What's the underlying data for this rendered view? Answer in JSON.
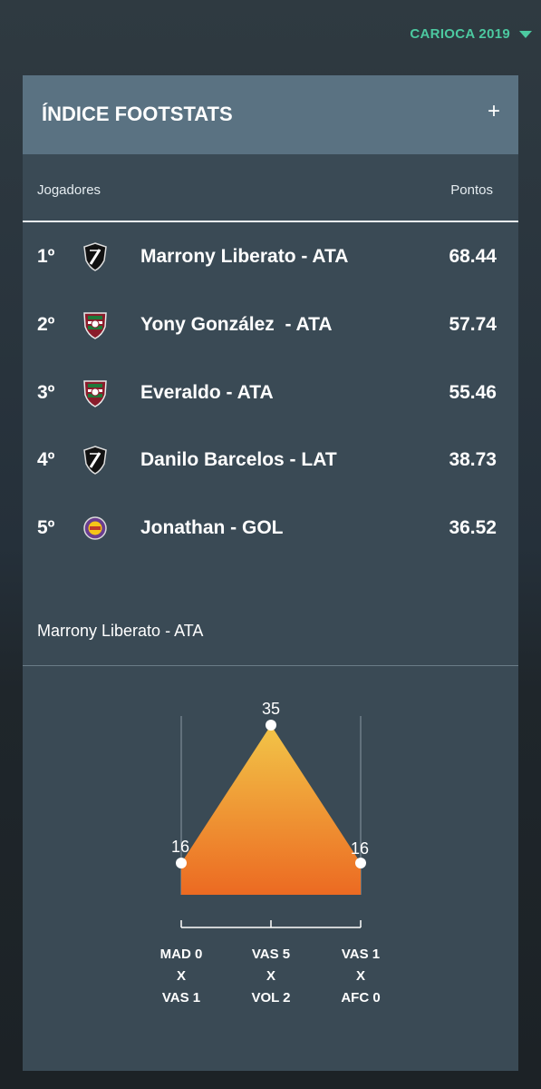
{
  "season_selector": {
    "label": "CARIOCA 2019"
  },
  "card": {
    "title": "ÍNDICE FOOTSTATS",
    "expand_label": "+",
    "columns": {
      "players": "Jogadores",
      "points": "Pontos"
    }
  },
  "rankings": [
    {
      "rank": "1º",
      "player": "Marrony Liberato - ATA",
      "points": "68.44",
      "crest": "vasco-crest-icon"
    },
    {
      "rank": "2º",
      "player": "Yony González  - ATA",
      "points": "57.74",
      "crest": "fluminense-crest-icon"
    },
    {
      "rank": "3º",
      "player": "Everaldo - ATA",
      "points": "55.46",
      "crest": "fluminense-crest-icon"
    },
    {
      "rank": "4º",
      "player": "Danilo Barcelos - LAT",
      "points": "38.73",
      "crest": "vasco-crest-icon"
    },
    {
      "rank": "5º",
      "player": "Jonathan - GOL",
      "points": "36.52",
      "crest": "madureira-crest-icon"
    }
  ],
  "detail": {
    "title": "Marrony Liberato - ATA"
  },
  "chart_data": {
    "type": "area",
    "categories": [
      [
        "MAD 0",
        "X",
        "VAS 1"
      ],
      [
        "VAS 5",
        "X",
        "VOL 2"
      ],
      [
        "VAS 1",
        "X",
        "AFC 0"
      ]
    ],
    "values": [
      16,
      35,
      16
    ],
    "data_labels": [
      "16",
      "35",
      "16"
    ],
    "colors": {
      "top": "#f2c548",
      "bottom": "#ec6a22",
      "point": "#ffffff"
    },
    "title": "",
    "xlabel": "",
    "ylabel": ""
  },
  "colors": {
    "accent": "#4cc9a0",
    "card": "#3a4a55",
    "header": "#5a7282"
  }
}
